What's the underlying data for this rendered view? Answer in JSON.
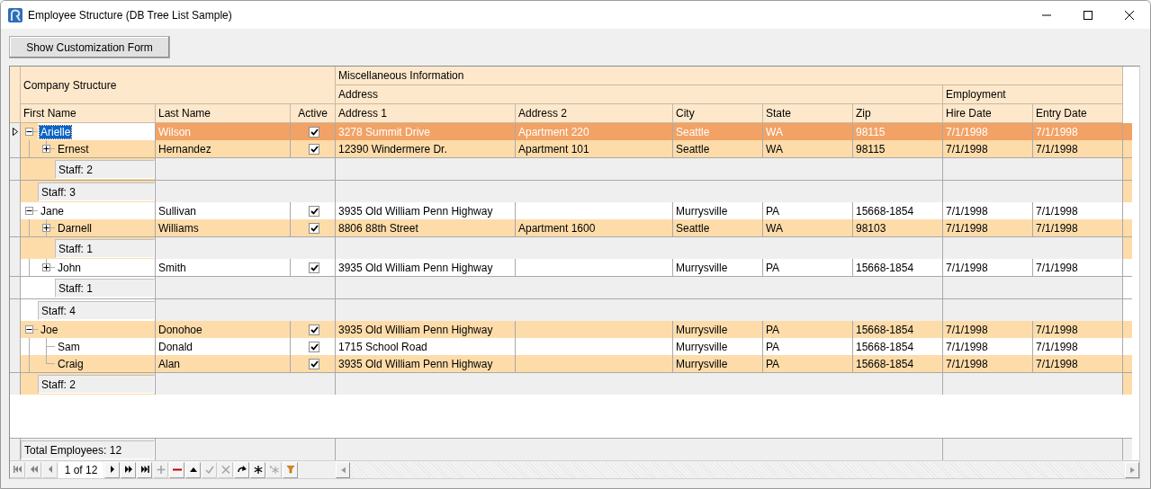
{
  "window": {
    "title": "Employee Structure (DB Tree List Sample)"
  },
  "toolbar": {
    "button": "Show Customization Form"
  },
  "grid": {
    "bands": {
      "company": "Company Structure",
      "misc": "Miscellaneous Information",
      "address": "Address",
      "employment": "Employment"
    },
    "columns": [
      "First Name",
      "Last Name",
      "Active",
      "Address 1",
      "Address 2",
      "City",
      "State",
      "Zip",
      "Hire Date",
      "Entry Date"
    ],
    "rows": [
      {
        "first": "Arielle",
        "last": "Wilson",
        "active": true,
        "address1": "3278 Summit Drive",
        "address2": "Apartment 220",
        "city": "Seattle",
        "state": "WA",
        "zip": "98115",
        "hire_date": "7/1/1998",
        "entry_date": "7/1/1998",
        "selected": true,
        "expanded": true,
        "footer": "Staff: 3",
        "children": [
          {
            "first": "Ernest",
            "last": "Hernandez",
            "active": true,
            "address1": "12390 Windermere Dr.",
            "address2": "Apartment 101",
            "city": "Seattle",
            "state": "WA",
            "zip": "98115",
            "hire_date": "7/1/1998",
            "entry_date": "7/1/1998",
            "selected": false,
            "expanded": false,
            "footer": "Staff: 2"
          }
        ]
      },
      {
        "first": "Jane",
        "last": "Sullivan",
        "active": true,
        "address1": "3935 Old William Penn Highway",
        "city": "Murrysville",
        "state": "PA",
        "zip": "15668-1854",
        "hire_date": "7/1/1998",
        "entry_date": "7/1/1998",
        "selected": false,
        "expanded": true,
        "footer": "Staff: 4",
        "children": [
          {
            "first": "Darnell",
            "last": "Williams",
            "active": true,
            "address1": "8806 88th Street",
            "address2": "Apartment 1600",
            "city": "Seattle",
            "state": "WA",
            "zip": "98103",
            "hire_date": "7/1/1998",
            "entry_date": "7/1/1998",
            "selected": false,
            "expanded": false,
            "footer": "Staff: 1"
          },
          {
            "first": "John",
            "last": "Smith",
            "active": true,
            "address1": "3935 Old William Penn Highway",
            "city": "Murrysville",
            "state": "PA",
            "zip": "15668-1854",
            "hire_date": "7/1/1998",
            "entry_date": "7/1/1998",
            "selected": false,
            "expanded": false,
            "footer": "Staff: 1"
          }
        ]
      },
      {
        "first": "Joe",
        "last": "Donohoe",
        "active": true,
        "address1": "3935 Old William Penn Highway",
        "city": "Murrysville",
        "state": "PA",
        "zip": "15668-1854",
        "hire_date": "7/1/1998",
        "entry_date": "7/1/1998",
        "selected": false,
        "expanded": true,
        "footer": "Staff: 2",
        "children": [
          {
            "first": "Sam",
            "last": "Donald",
            "active": true,
            "address1": "1715 School Road",
            "city": "Murrysville",
            "state": "PA",
            "zip": "15668-1854",
            "hire_date": "7/1/1998",
            "entry_date": "7/1/1998",
            "selected": false
          },
          {
            "first": "Craig",
            "last": "Alan",
            "active": true,
            "address1": "3935 Old William Penn Highway",
            "city": "Murrysville",
            "state": "PA",
            "zip": "15668-1854",
            "hire_date": "7/1/1998",
            "entry_date": "7/1/1998",
            "selected": false
          }
        ]
      }
    ],
    "total_footer": "Total Employees: 12",
    "navigator": {
      "position": "1 of 12",
      "buttons": [
        {
          "kind": "first",
          "disabled": true
        },
        {
          "kind": "prior_page",
          "disabled": true
        },
        {
          "kind": "prior",
          "disabled": true
        },
        {
          "kind": "position"
        },
        {
          "kind": "next",
          "disabled": false
        },
        {
          "kind": "next_page",
          "disabled": false
        },
        {
          "kind": "last",
          "disabled": false
        },
        {
          "kind": "insert",
          "disabled": true
        },
        {
          "kind": "delete",
          "disabled": false
        },
        {
          "kind": "edit",
          "disabled": false
        },
        {
          "kind": "post",
          "disabled": true
        },
        {
          "kind": "cancel",
          "disabled": true
        },
        {
          "kind": "refresh",
          "disabled": false
        },
        {
          "kind": "set_bookmark",
          "disabled": false
        },
        {
          "kind": "goto_bookmark",
          "disabled": true
        },
        {
          "kind": "filter",
          "disabled": false
        }
      ]
    }
  }
}
